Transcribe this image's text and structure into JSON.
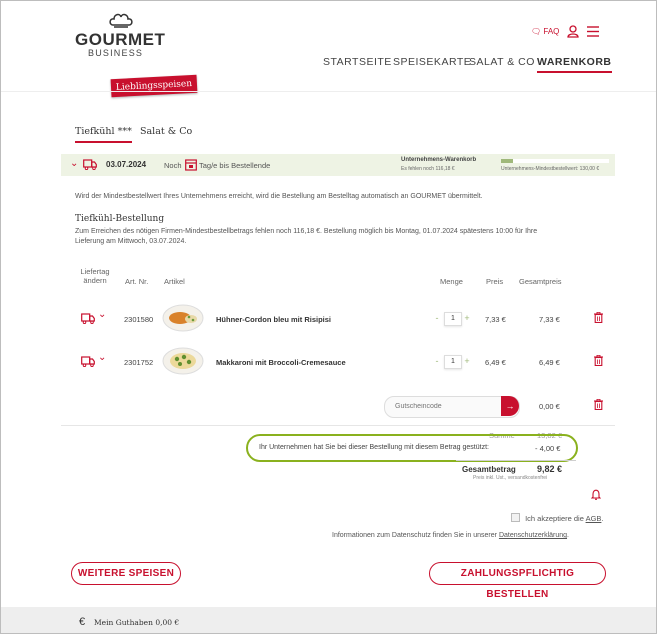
{
  "brand": {
    "logo_top": "GOURMET",
    "logo_sub": "BUSINESS",
    "ribbon": "Lieblingsspeisen"
  },
  "topbar": {
    "faq_label": "FAQ"
  },
  "nav": {
    "items": [
      "STARTSEITE",
      "SPEISEKARTE",
      "SALAT & CO",
      "WARENKORB"
    ],
    "active_index": 3
  },
  "tabs": [
    {
      "label": "Tiefkühl ***",
      "active": true
    },
    {
      "label": "Salat & Co",
      "active": false
    }
  ],
  "delivery_bar": {
    "date": "03.07.2024",
    "countdown_prefix": "Noch",
    "countdown_suffix": "Tag/e bis Bestellende",
    "cart_title": "Unternehmens-Warenkorb",
    "cart_missing": "Es fehlen noch 116,18 €",
    "cart_min": "Unternehmens-Mindestbestellwert: 130,00 €",
    "progress_fraction": 0.11
  },
  "info_text": "Wird der Mindestbestellwert Ihres Unternehmens erreicht, wird die Bestellung am Bestelltag automatisch an GOURMET übermittelt.",
  "order": {
    "title": "Tiefkühl-Bestellung",
    "desc_line1": "Zum Erreichen des nötigen Firmen-Mindestbestellbetrags fehlen noch 116,18 €. Bestellung möglich bis Montag, 01.07.2024 spätestens 10:00 für Ihre",
    "desc_line2": "Lieferung am Mittwoch, 03.07.2024."
  },
  "table": {
    "headers": {
      "liefertag_1": "Liefertag",
      "liefertag_2": "ändern",
      "artnr": "Art. Nr.",
      "artikel": "Artikel",
      "menge": "Menge",
      "preis": "Preis",
      "gesamtpreis": "Gesamtpreis"
    },
    "rows": [
      {
        "artnr": "2301580",
        "name": "Hühner-Cordon bleu mit Risipisi",
        "qty": "1",
        "price": "7,33 €",
        "total": "7,33 €"
      },
      {
        "artnr": "2301752",
        "name": "Makkaroni mit Broccoli-Cremesauce",
        "qty": "1",
        "price": "6,49 €",
        "total": "6,49 €"
      }
    ]
  },
  "voucher": {
    "placeholder": "Gutscheincode",
    "amount": "0,00 €"
  },
  "totals": {
    "summe_label": "Summe",
    "summe_value": "13,82 €",
    "subsidy_label": "Ihr Unternehmen hat Sie bei dieser Bestellung mit diesem Betrag gestützt:",
    "subsidy_value": "- 4,00 €",
    "gesamt_label": "Gesamtbetrag",
    "gesamt_value": "9,82 €",
    "gesamt_note": "Preis inkl. Ust., versandkostenfrei"
  },
  "agb": {
    "prefix": "Ich akzeptiere die",
    "link": "AGB",
    "suffix": "."
  },
  "privacy": {
    "prefix": "Informationen zum Datenschutz finden Sie in unserer",
    "link": "Datenschutzerklärung",
    "suffix": "."
  },
  "buttons": {
    "more": "WEITERE SPEISEN",
    "order": "ZAHLUNGSPFLICHTIG BESTELLEN"
  },
  "footer": {
    "balance": "Mein Guthaben 0,00 €"
  },
  "colors": {
    "brand_red": "#c8102e",
    "highlight_green": "#8ab11e",
    "delivery_bar_bg": "#eef3e4"
  }
}
